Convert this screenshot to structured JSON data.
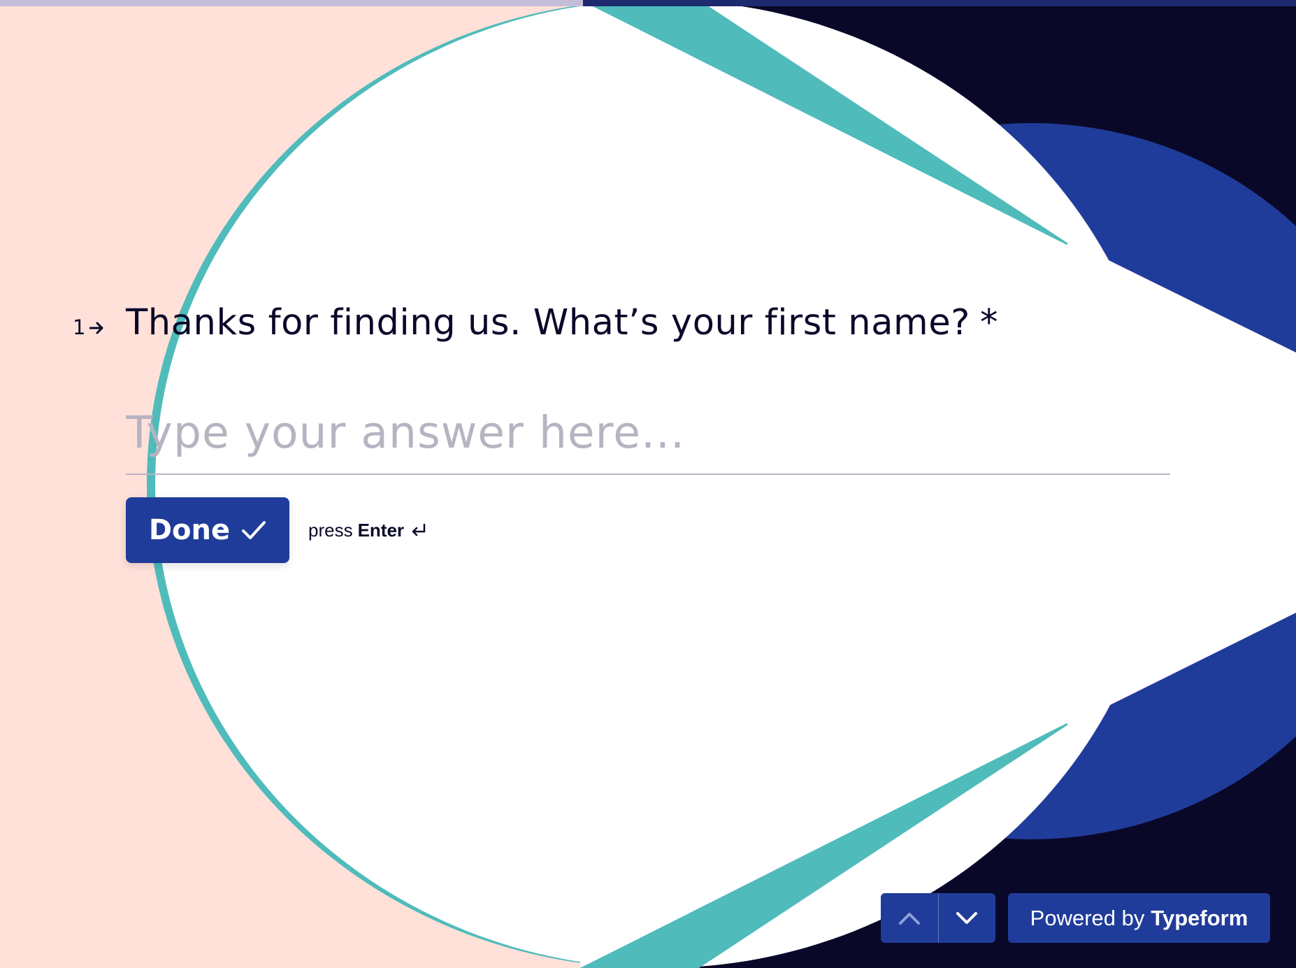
{
  "progress": {
    "fraction": 0.45,
    "fill_color": "#c5bdd8",
    "track_color": "#1e2a6e"
  },
  "colors": {
    "background_left": "#ffe1da",
    "circle": "#ffffff",
    "teal": "#4fbbbb",
    "navy": "#0a0829",
    "blue": "#203c9a",
    "placeholder": "#b6b4c1"
  },
  "question": {
    "number": "1",
    "arrow_icon": "arrow-right-icon",
    "text": "Thanks for finding us. What’s your first name?",
    "required_marker": "*"
  },
  "answer": {
    "value": "",
    "placeholder": "Type your answer here..."
  },
  "done_button": {
    "label": "Done",
    "icon": "checkmark-icon"
  },
  "enter_hint": {
    "prefix": "press",
    "key": "Enter",
    "icon": "return-key-icon"
  },
  "navigation": {
    "up_icon": "chevron-up-icon",
    "down_icon": "chevron-down-icon"
  },
  "branding": {
    "prefix": "Powered by",
    "brand": "Typeform"
  }
}
